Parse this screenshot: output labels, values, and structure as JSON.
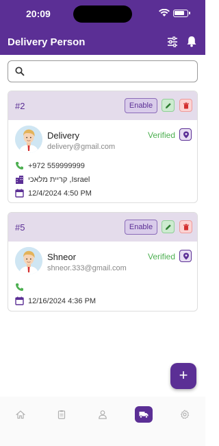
{
  "status_bar": {
    "time": "20:09"
  },
  "header": {
    "title": "Delivery Person"
  },
  "search": {
    "value": "",
    "placeholder": ""
  },
  "cards": [
    {
      "id": "#2",
      "enable_label": "Enable",
      "name": "Delivery",
      "email": "delivery@gmail.com",
      "verified_label": "Verified",
      "phone": "+972 559999999",
      "address": "קריית מלאכי ,Israel",
      "date": "12/4/2024 4:50 PM"
    },
    {
      "id": "#5",
      "enable_label": "Enable",
      "name": "Shneor",
      "email": "shneor.333@gmail.com",
      "verified_label": "Verified",
      "phone": "",
      "date": "12/16/2024 4:36 PM"
    }
  ],
  "fab": {
    "label": "+"
  },
  "colors": {
    "primary": "#5b2f95",
    "verified": "#4caf50",
    "header_bg": "#e4dceb"
  }
}
